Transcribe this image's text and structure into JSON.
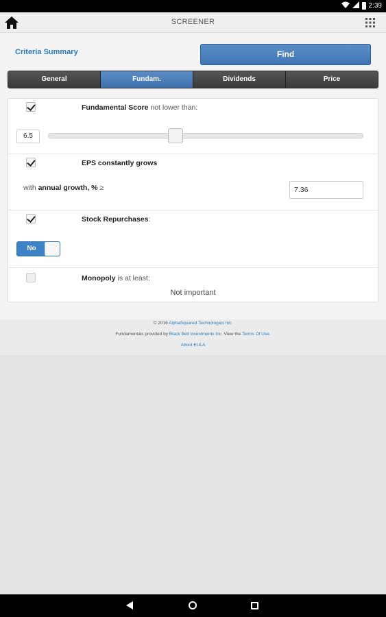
{
  "status": {
    "time": "2:39"
  },
  "appbar": {
    "title": "SCREENER"
  },
  "criteria": {
    "summary_link": "Criteria Summary",
    "find_label": "Find"
  },
  "tabs": [
    {
      "label": "General"
    },
    {
      "label": "Fundam."
    },
    {
      "label": "Dividends"
    },
    {
      "label": "Price"
    }
  ],
  "fundamental_score": {
    "checked": true,
    "label_bold": "Fundamental Score",
    "label_rest": " not lower than:",
    "value": "6.5",
    "slider_fraction": 0.4
  },
  "eps": {
    "checked": true,
    "label_bold": "EPS constantly grows",
    "growth_prefix": "with ",
    "growth_bold": "annual growth, %",
    "growth_suffix": " ≥",
    "growth_value": "7.36"
  },
  "repurchases": {
    "checked": true,
    "label_bold": "Stock Repurchases",
    "label_rest": ":",
    "toggle_label": "No"
  },
  "monopoly": {
    "checked": false,
    "label_bold": "Monopoly",
    "label_rest": " is at least:",
    "value": "Not important"
  },
  "footer": {
    "copyright_prefix": "© 2016 ",
    "copyright_company": "AlphaSquared Technologies Inc.",
    "provider_prefix": "Fundamentals provided by ",
    "provider_name": "Black Belt Investments Inc.",
    "provider_middle": " View the ",
    "terms_link": "Terms Of Use.",
    "about_link": "About EULA"
  }
}
